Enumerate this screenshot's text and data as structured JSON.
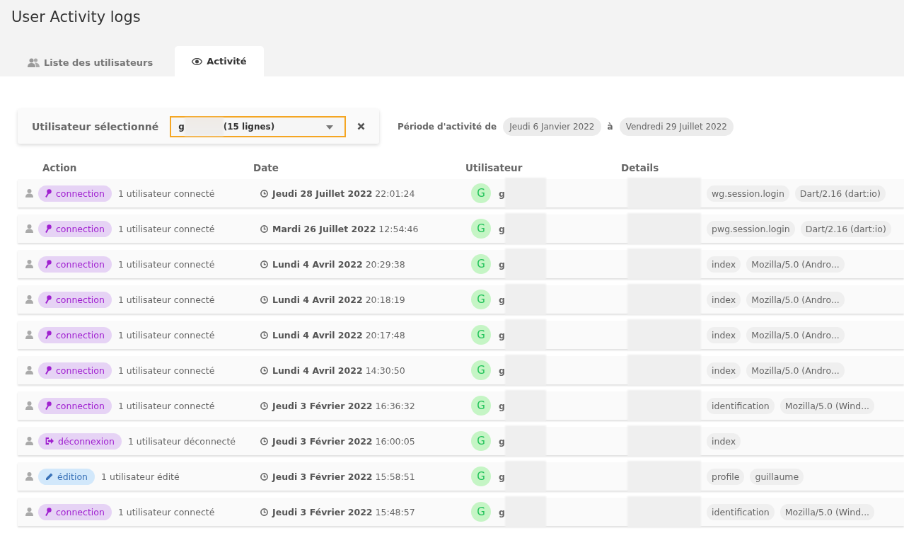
{
  "title": "User Activity logs",
  "tabs": [
    {
      "label": "Liste des utilisateurs",
      "selected": false
    },
    {
      "label": "Activité",
      "selected": true
    }
  ],
  "filter": {
    "label": "Utilisateur sélectionné",
    "value_start": "g",
    "value_end": "(15 lignes)",
    "period_label": "Période d'activité de",
    "period_from": "Jeudi 6 Janvier 2022",
    "period_sep": "à",
    "period_to": "Vendredi 29 Juillet 2022"
  },
  "columns": [
    "Action",
    "Date",
    "Utilisateur",
    "Details"
  ],
  "rows": [
    {
      "kind": "connection",
      "action": "connection",
      "description": "1 utilisateur connecté",
      "date": "Jeudi 28 Juillet 2022",
      "time": "22:01:24",
      "avatar": "G",
      "user": "g",
      "details": [
        "wg.session.login",
        "Dart/2.16 (dart:io)"
      ]
    },
    {
      "kind": "connection",
      "action": "connection",
      "description": "1 utilisateur connecté",
      "date": "Mardi 26 Juillet 2022",
      "time": "12:54:46",
      "avatar": "G",
      "user": "g",
      "details": [
        "pwg.session.login",
        "Dart/2.16 (dart:io)"
      ]
    },
    {
      "kind": "connection",
      "action": "connection",
      "description": "1 utilisateur connecté",
      "date": "Lundi 4 Avril 2022",
      "time": "20:29:38",
      "avatar": "G",
      "user": "g",
      "details": [
        "index",
        "Mozilla/5.0 (Andro..."
      ]
    },
    {
      "kind": "connection",
      "action": "connection",
      "description": "1 utilisateur connecté",
      "date": "Lundi 4 Avril 2022",
      "time": "20:18:19",
      "avatar": "G",
      "user": "g",
      "details": [
        "index",
        "Mozilla/5.0 (Andro..."
      ]
    },
    {
      "kind": "connection",
      "action": "connection",
      "description": "1 utilisateur connecté",
      "date": "Lundi 4 Avril 2022",
      "time": "20:17:48",
      "avatar": "G",
      "user": "g",
      "details": [
        "index",
        "Mozilla/5.0 (Andro..."
      ]
    },
    {
      "kind": "connection",
      "action": "connection",
      "description": "1 utilisateur connecté",
      "date": "Lundi 4 Avril 2022",
      "time": "14:30:50",
      "avatar": "G",
      "user": "g",
      "details": [
        "index",
        "Mozilla/5.0 (Andro..."
      ]
    },
    {
      "kind": "connection",
      "action": "connection",
      "description": "1 utilisateur connecté",
      "date": "Jeudi 3 Février 2022",
      "time": "16:36:32",
      "avatar": "G",
      "user": "g",
      "details": [
        "identification",
        "Mozilla/5.0 (Wind..."
      ]
    },
    {
      "kind": "deconnexion",
      "action": "déconnexion",
      "description": "1 utilisateur déconnecté",
      "date": "Jeudi 3 Février 2022",
      "time": "16:00:05",
      "avatar": "G",
      "user": "g",
      "details": [
        "index"
      ]
    },
    {
      "kind": "edition",
      "action": "édition",
      "description": "1 utilisateur édité",
      "date": "Jeudi 3 Février 2022",
      "time": "15:58:51",
      "avatar": "G",
      "user": "g",
      "details": [
        "profile",
        "guillaume"
      ]
    },
    {
      "kind": "connection",
      "action": "connection",
      "description": "1 utilisateur connecté",
      "date": "Jeudi 3 Février 2022",
      "time": "15:48:57",
      "avatar": "G",
      "user": "g",
      "details": [
        "identification",
        "Mozilla/5.0 (Wind..."
      ]
    }
  ]
}
